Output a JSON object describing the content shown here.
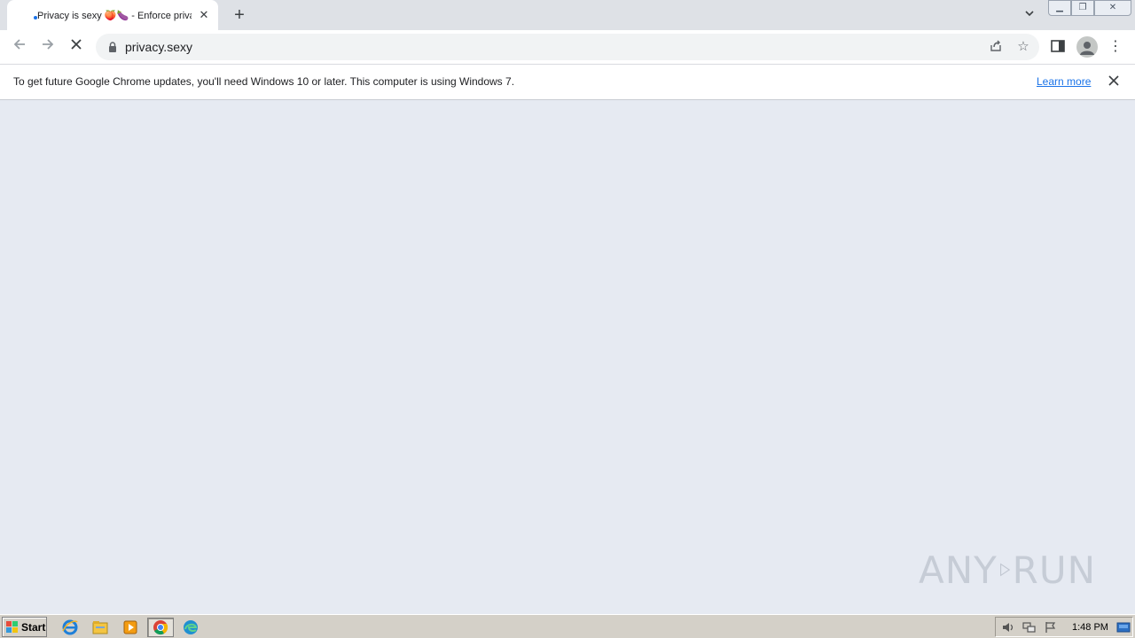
{
  "tab": {
    "title": "Privacy is sexy 🍑🍆 - Enforce privacy & security best-practices on Windows, macOS and Linux"
  },
  "address_bar": {
    "url": "privacy.sexy"
  },
  "infobar": {
    "message": "To get future Google Chrome updates, you'll need Windows 10 or later. This computer is using Windows 7.",
    "link": "Learn more"
  },
  "watermark": {
    "left": "ANY",
    "right": "RUN"
  },
  "taskbar": {
    "start_label": "Start",
    "clock": "1:48 PM"
  },
  "colors": {
    "accent": "#1a73e8",
    "content_bg": "#e6eaf2",
    "tabstrip_bg": "#dee1e6"
  }
}
